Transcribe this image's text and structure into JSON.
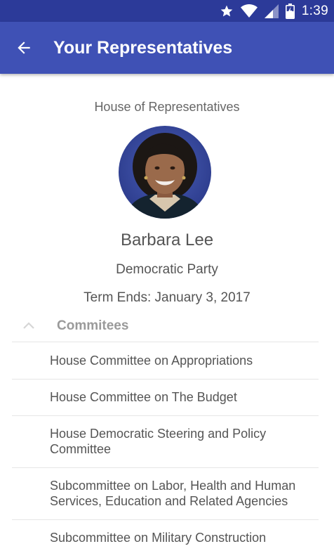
{
  "status_bar": {
    "time": "1:39",
    "icons": [
      "star-icon",
      "wifi-icon",
      "cell-signal-icon",
      "battery-charging-icon"
    ]
  },
  "app_bar": {
    "title": "Your Representatives",
    "back_icon": "arrow-back-icon",
    "color": "#3f51b5",
    "status_color": "#2c3a99"
  },
  "representative": {
    "chamber": "House of Representatives",
    "name": "Barbara Lee",
    "party": "Democratic Party",
    "term_ends": "Term Ends: January 3, 2017"
  },
  "committees": {
    "header": "Commitees",
    "expanded_icon": "chevron-up-icon",
    "items": [
      "House Committee on Appropriations",
      "House Committee on The Budget",
      "House Democratic Steering and Policy Committee",
      "Subcommittee on Labor, Health and Human Services, Education and Related Agencies",
      "Subcommittee on Military Construction"
    ]
  }
}
